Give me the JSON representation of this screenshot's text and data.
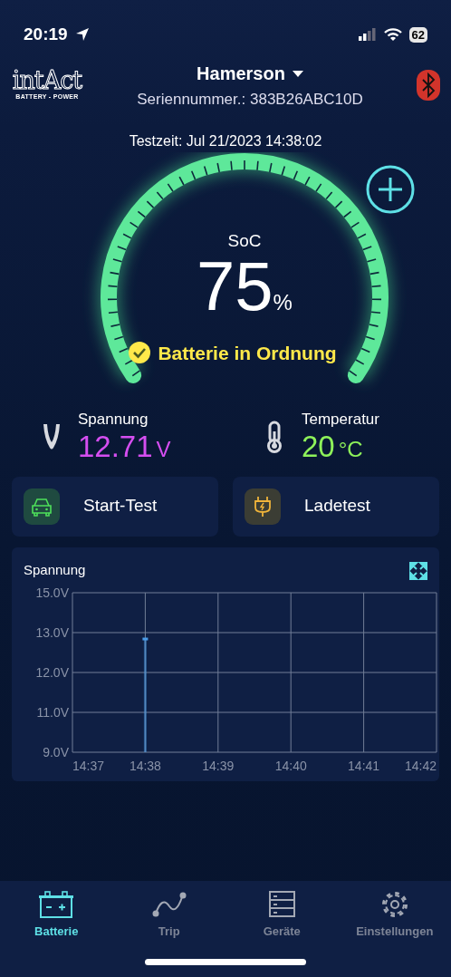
{
  "status_bar": {
    "time": "20:19",
    "battery": "62"
  },
  "header": {
    "logo": "intAct",
    "logo_tagline": "BATTERY - POWER",
    "device": "Hamerson",
    "serial": "Seriennummer.: 383B26ABC10D"
  },
  "test_time": "Testzeit: Jul 21/2023 14:38:02",
  "gauge": {
    "label": "SoC",
    "value": "75",
    "unit": "%",
    "status": "Batterie in Ordnung"
  },
  "readings": [
    {
      "kind": "voltage",
      "label": "Spannung",
      "value": "12.71",
      "unit": "V",
      "color": "#d54ef0"
    },
    {
      "kind": "temperature",
      "label": "Temperatur",
      "value": "20",
      "unit": "°C",
      "color": "#8ef25a"
    }
  ],
  "actions": [
    {
      "kind": "car",
      "label": "Start-Test"
    },
    {
      "kind": "plug",
      "label": "Ladetest"
    }
  ],
  "chart": {
    "title": "Spannung",
    "y_labels": [
      "15.0V",
      "13.0V",
      "12.0V",
      "11.0V",
      "9.0V"
    ],
    "x_labels": [
      "14:37",
      "14:38",
      "14:39",
      "14:40",
      "14:41",
      "14:42"
    ]
  },
  "tabs": [
    {
      "kind": "battery",
      "label": "Batterie",
      "selected": true
    },
    {
      "kind": "trip",
      "label": "Trip",
      "selected": false
    },
    {
      "kind": "devices",
      "label": "Geräte",
      "selected": false
    },
    {
      "kind": "settings",
      "label": "Einstellungen",
      "selected": false
    }
  ]
}
